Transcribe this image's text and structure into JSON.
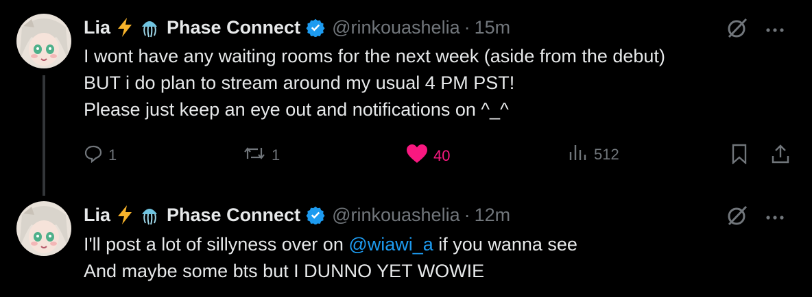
{
  "tweets": [
    {
      "author": {
        "name": "Lia",
        "affiliation": "Phase Connect",
        "handle": "@rinkouashelia",
        "emoji": [
          "lightning-bolt",
          "jellyfish"
        ]
      },
      "time": "15m",
      "dot": "·",
      "text": "I wont have any waiting rooms for the next week (aside from the debut)\nBUT i do plan to stream around my usual 4 PM PST!\nPlease just keep an eye out and notifications on ^_^",
      "stats": {
        "replies": "1",
        "reposts": "1",
        "likes": "40",
        "views": "512"
      }
    },
    {
      "author": {
        "name": "Lia",
        "affiliation": "Phase Connect",
        "handle": "@rinkouashelia",
        "emoji": [
          "lightning-bolt",
          "jellyfish"
        ]
      },
      "time": "12m",
      "dot": "·",
      "text_before": "I'll post a lot of sillyness over on ",
      "mention": "@wiawi_a",
      "text_after": " if you wanna see\nAnd maybe some bts but I DUNNO YET WOWIE"
    }
  ],
  "colors": {
    "background": "#000000",
    "text": "#e7e9ea",
    "muted": "#71767b",
    "link": "#1d9bf0",
    "like": "#f91880",
    "verified": "#1d9bf0"
  }
}
